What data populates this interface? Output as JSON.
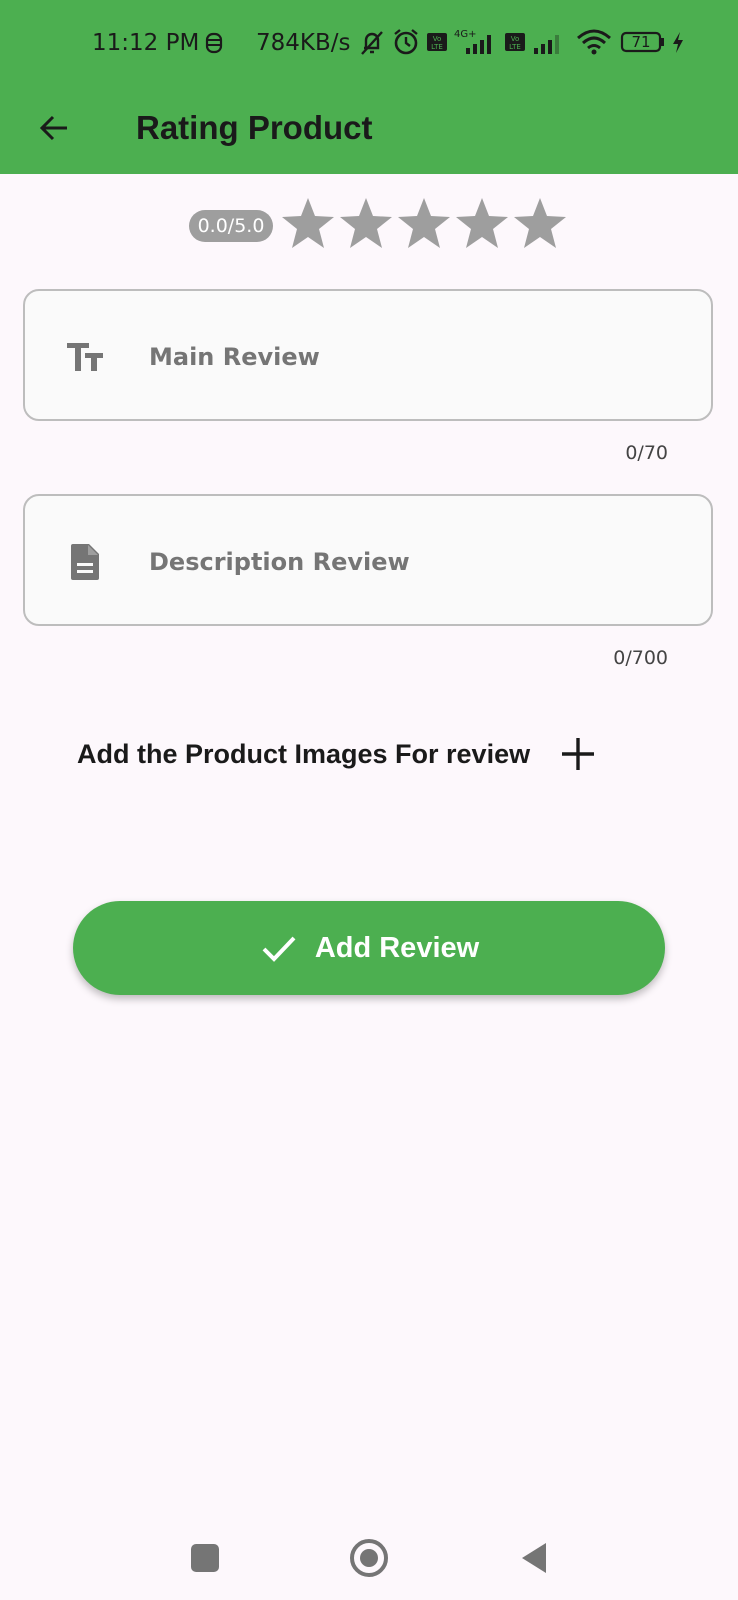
{
  "status_bar": {
    "time": "11:12 PM",
    "net_speed": "784KB/s",
    "battery": "71",
    "icons": [
      "data-saver-icon",
      "mute-icon",
      "alarm-icon",
      "volte-icon",
      "signal-4g-icon",
      "volte-icon",
      "signal-icon",
      "wifi-icon",
      "battery-icon",
      "charging-icon"
    ]
  },
  "app_bar": {
    "title": "Rating Product",
    "back_icon": "arrow-back-icon",
    "color": "#4caf50"
  },
  "rating": {
    "value_text": "0.0/5.0",
    "value": 0.0,
    "max": 5,
    "star_color": "#9e9e9e"
  },
  "main_review": {
    "placeholder": "Main Review",
    "value": "",
    "counter": "0/70",
    "icon": "text-fields-icon"
  },
  "description_review": {
    "placeholder": "Description Review",
    "value": "",
    "counter": "0/700",
    "icon": "description-icon"
  },
  "images": {
    "label": "Add the Product Images For review",
    "icon": "plus-icon"
  },
  "submit": {
    "label": "Add Review",
    "icon": "check-icon",
    "color": "#4caf50"
  },
  "nav_bar": {
    "icons": [
      "recents-square-icon",
      "home-circle-icon",
      "back-triangle-icon"
    ]
  }
}
